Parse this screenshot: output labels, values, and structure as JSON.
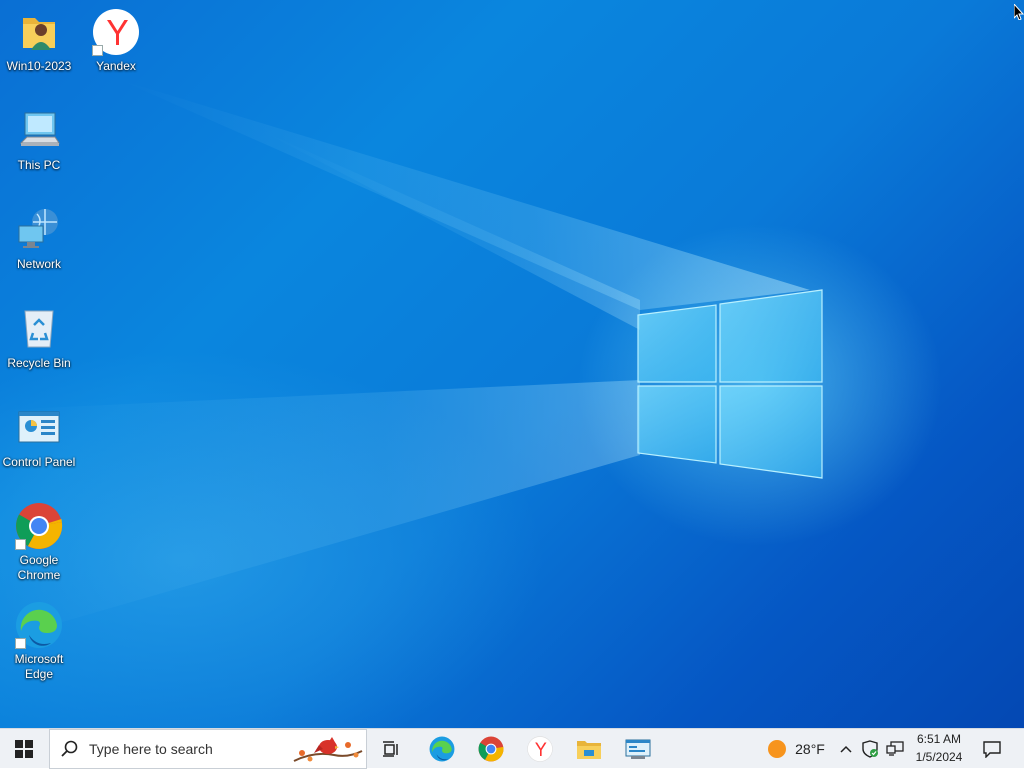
{
  "desktop": {
    "icons": [
      {
        "label": "Win10-2023",
        "icon": "user-folder-icon"
      },
      {
        "label": "Yandex",
        "icon": "yandex-icon"
      },
      {
        "label": "This PC",
        "icon": "computer-icon"
      },
      {
        "label": "Network",
        "icon": "network-icon"
      },
      {
        "label": "Recycle Bin",
        "icon": "recycle-bin-icon"
      },
      {
        "label": "Control Panel",
        "icon": "control-panel-icon"
      },
      {
        "label": "Google Chrome",
        "icon": "chrome-icon"
      },
      {
        "label": "Microsoft Edge",
        "icon": "edge-icon"
      }
    ]
  },
  "taskbar": {
    "search_placeholder": "Type here to search",
    "pinned": [
      "task-view-icon",
      "edge-icon",
      "chrome-icon",
      "yandex-icon",
      "file-explorer-icon",
      "control-panel-icon"
    ],
    "weather": "28°F",
    "clock_time": "6:51 AM",
    "clock_date": "1/5/2024"
  },
  "colors": {
    "taskbar_bg": "#eef1f5",
    "desktop_blue": "#0a7ad8"
  }
}
